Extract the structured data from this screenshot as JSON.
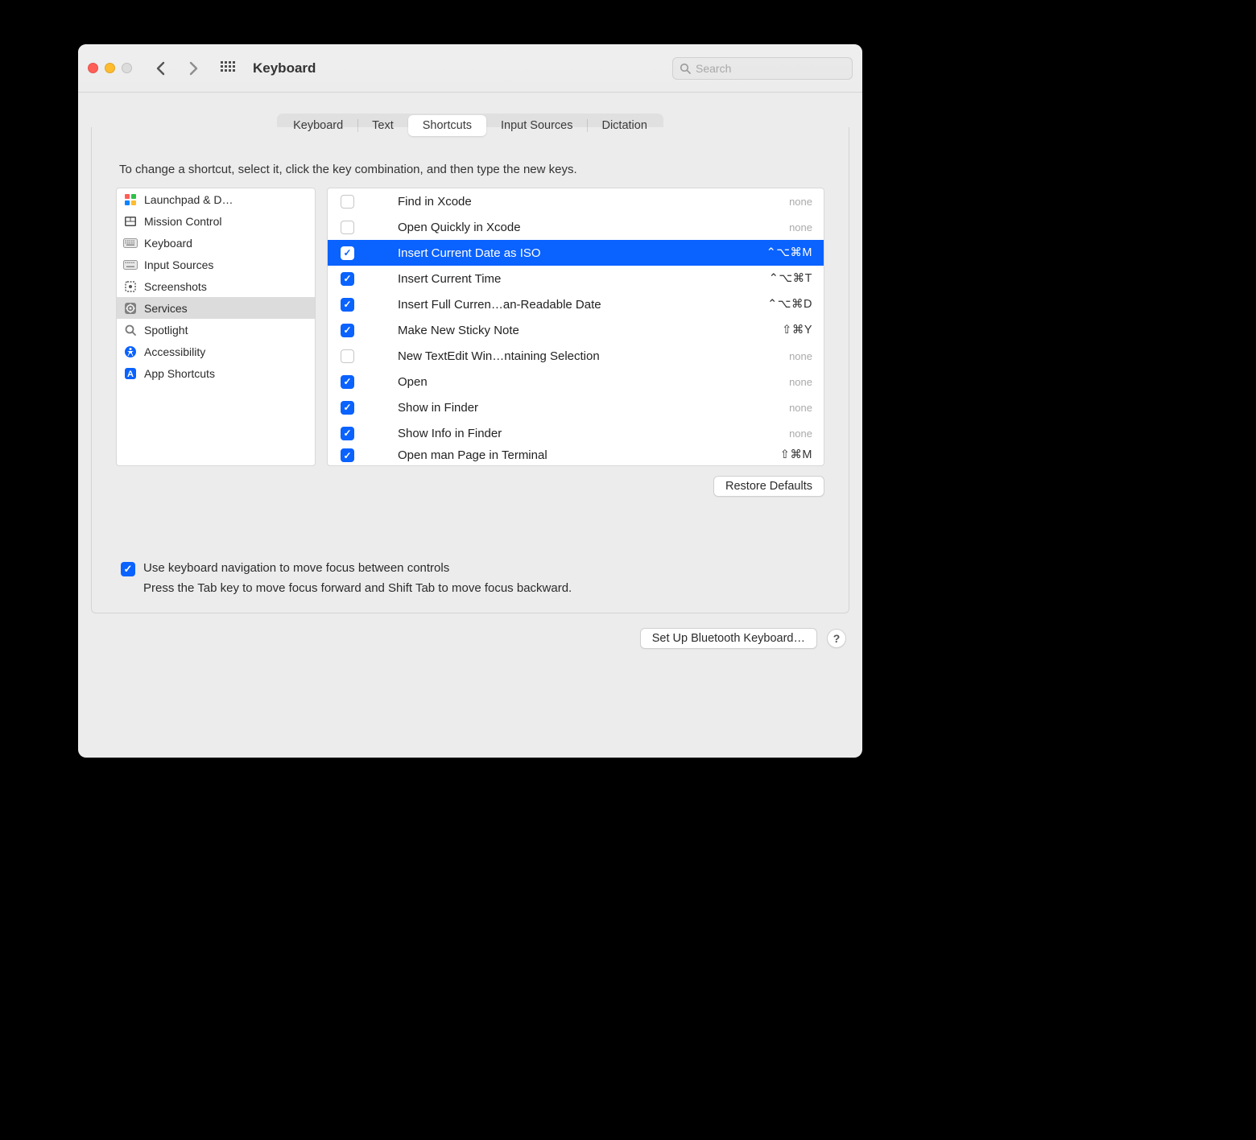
{
  "titlebar": {
    "title": "Keyboard",
    "search_placeholder": "Search"
  },
  "tabs": [
    {
      "label": "Keyboard"
    },
    {
      "label": "Text"
    },
    {
      "label": "Shortcuts"
    },
    {
      "label": "Input Sources"
    },
    {
      "label": "Dictation"
    }
  ],
  "active_tab": 2,
  "instruction": "To change a shortcut, select it, click the key combination, and then type the new keys.",
  "categories": [
    {
      "label": "Launchpad & D…",
      "icon": "launchpad"
    },
    {
      "label": "Mission Control",
      "icon": "mission"
    },
    {
      "label": "Keyboard",
      "icon": "keyboard"
    },
    {
      "label": "Input Sources",
      "icon": "input"
    },
    {
      "label": "Screenshots",
      "icon": "screenshot"
    },
    {
      "label": "Services",
      "icon": "services"
    },
    {
      "label": "Spotlight",
      "icon": "spotlight"
    },
    {
      "label": "Accessibility",
      "icon": "accessibility"
    },
    {
      "label": "App Shortcuts",
      "icon": "appshortcuts"
    }
  ],
  "selected_category": 5,
  "shortcuts": [
    {
      "checked": false,
      "label": "Find in Xcode",
      "keys": "",
      "none": true
    },
    {
      "checked": false,
      "label": "Open Quickly in Xcode",
      "keys": "",
      "none": true
    },
    {
      "checked": true,
      "label": "Insert Current Date as ISO",
      "keys": "⌃⌥⌘M",
      "none": false,
      "selected": true
    },
    {
      "checked": true,
      "label": "Insert Current Time",
      "keys": "⌃⌥⌘T",
      "none": false
    },
    {
      "checked": true,
      "label": "Insert Full Curren…an-Readable Date",
      "keys": "⌃⌥⌘D",
      "none": false
    },
    {
      "checked": true,
      "label": "Make New Sticky Note",
      "keys": "⇧⌘Y",
      "none": false
    },
    {
      "checked": false,
      "label": "New TextEdit Win…ntaining Selection",
      "keys": "",
      "none": true
    },
    {
      "checked": true,
      "label": "Open",
      "keys": "",
      "none": true
    },
    {
      "checked": true,
      "label": "Show in Finder",
      "keys": "",
      "none": true
    },
    {
      "checked": true,
      "label": "Show Info in Finder",
      "keys": "",
      "none": true
    },
    {
      "checked": true,
      "label": "Open man Page in Terminal",
      "keys": "⇧⌘M",
      "none": false,
      "partial": true
    }
  ],
  "none_label": "none",
  "restore_label": "Restore Defaults",
  "nav_option": {
    "checked": true,
    "title": "Use keyboard navigation to move focus between controls",
    "subtitle": "Press the Tab key to move focus forward and Shift Tab to move focus backward."
  },
  "footer": {
    "setup_label": "Set Up Bluetooth Keyboard…",
    "help": "?"
  }
}
